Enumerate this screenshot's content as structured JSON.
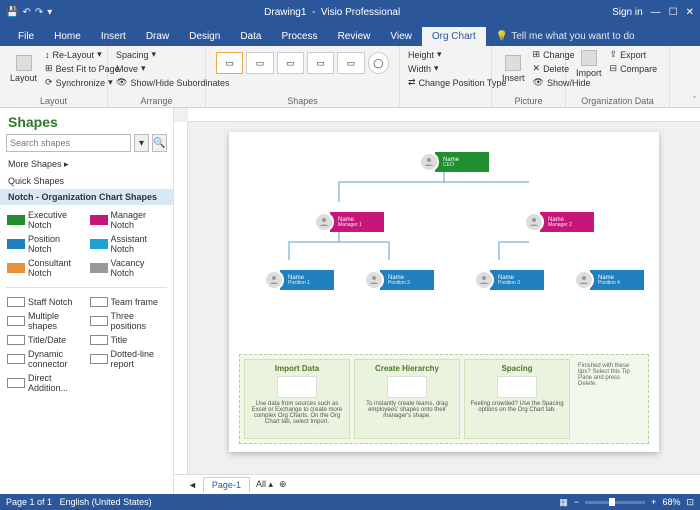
{
  "titlebar": {
    "doc": "Drawing1",
    "app": "Visio Professional",
    "signin": "Sign in"
  },
  "tabs": [
    "File",
    "Home",
    "Insert",
    "Draw",
    "Design",
    "Data",
    "Process",
    "Review",
    "View",
    "Org Chart"
  ],
  "active_tab": 9,
  "tellme": "Tell me what you want to do",
  "ribbon": {
    "layout": {
      "group": "Layout",
      "relayout": "Re-Layout",
      "bestfit": "Best Fit to Page",
      "sync": "Synchronize"
    },
    "arrange": {
      "group": "Arrange",
      "spacing": "Spacing",
      "move": "Move",
      "showhide": "Show/Hide Subordinates"
    },
    "shapes": {
      "group": "Shapes",
      "height": "Height",
      "width": "Width",
      "changepos": "Change Position Type"
    },
    "picture": {
      "group": "Picture",
      "insert": "Insert",
      "change": "Change",
      "delete": "Delete",
      "showhide": "Show/Hide"
    },
    "orgdata": {
      "group": "Organization Data",
      "import": "Import",
      "export": "Export",
      "compare": "Compare"
    }
  },
  "shapes_pane": {
    "title": "Shapes",
    "search_ph": "Search shapes",
    "more": "More Shapes",
    "quick": "Quick Shapes",
    "category": "Notch - Organization Chart Shapes",
    "items": [
      {
        "label": "Executive Notch",
        "color": "#1f8f2f"
      },
      {
        "label": "Manager Notch",
        "color": "#c7167a"
      },
      {
        "label": "Position Notch",
        "color": "#1f7fbf"
      },
      {
        "label": "Assistant Notch",
        "color": "#1fa3cf"
      },
      {
        "label": "Consultant Notch",
        "color": "#e8903a"
      },
      {
        "label": "Vacancy Notch",
        "color": "#999999"
      }
    ],
    "items2": [
      "Staff Notch",
      "Team frame",
      "Multiple shapes",
      "Three positions",
      "Title/Date",
      "Title",
      "Dynamic connector",
      "Dotted-line report",
      "Direct Addition..."
    ]
  },
  "chart": {
    "ceo": {
      "name": "Name",
      "role": "CEO",
      "color": "#1f8f2f"
    },
    "mgrs": [
      {
        "name": "Name",
        "role": "Manager 1",
        "color": "#c7167a"
      },
      {
        "name": "Name",
        "role": "Manager 2",
        "color": "#c7167a"
      }
    ],
    "pos": [
      {
        "name": "Name",
        "role": "Position 1",
        "color": "#1f7fbf"
      },
      {
        "name": "Name",
        "role": "Position 2",
        "color": "#1f7fbf"
      },
      {
        "name": "Name",
        "role": "Position 3",
        "color": "#1f7fbf"
      },
      {
        "name": "Name",
        "role": "Position 4",
        "color": "#1f7fbf"
      }
    ]
  },
  "hints": {
    "h1": {
      "t": "Import Data",
      "d": "Use data from sources such as Excel or Exchange to create more complex Org Charts. On the Org Chart tab, select Import."
    },
    "h2": {
      "t": "Create Hierarchy",
      "d": "To instantly create teams, drag employees' shapes onto their manager's shape."
    },
    "h3": {
      "t": "Spacing",
      "d": "Feeling crowded? Use the Spacing options on the Org Chart tab."
    },
    "side": "Finished with these tips? Select this Tip Pane and press Delete."
  },
  "page_tabs": {
    "page": "Page-1",
    "all": "All"
  },
  "status": {
    "pages": "Page 1 of 1",
    "lang": "English (United States)",
    "zoom": "68%"
  }
}
